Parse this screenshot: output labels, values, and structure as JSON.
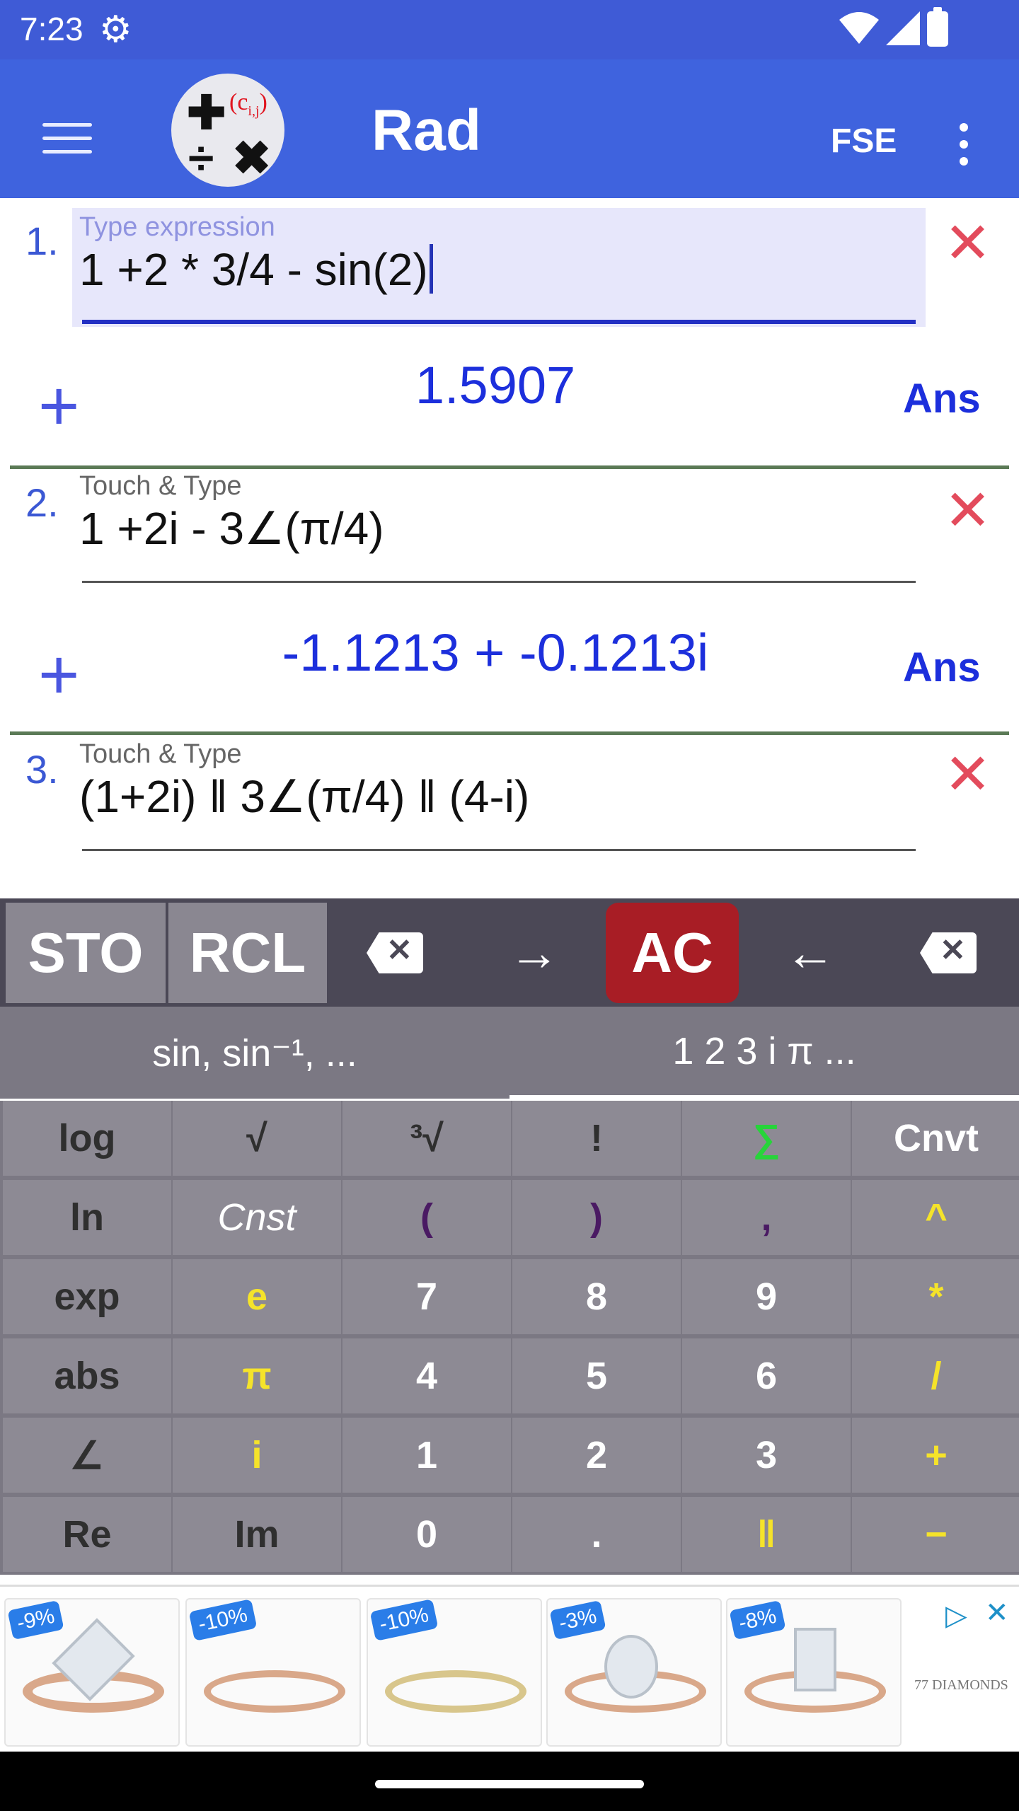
{
  "status": {
    "time": "7:23"
  },
  "appbar": {
    "mode": "Rad",
    "fse": "FSE",
    "logo_text": "c",
    "logo_sub": "i,j"
  },
  "entries": [
    {
      "num": "1.",
      "label": "Type expression",
      "expr": "1 +2 * 3/4 - sin(2)",
      "result": "1.5907",
      "ans": "Ans",
      "active": true
    },
    {
      "num": "2.",
      "label": "Touch & Type",
      "expr": "1 +2i - 3∠(π/4)",
      "result": "-1.1213 + -0.1213i",
      "ans": "Ans",
      "active": false
    },
    {
      "num": "3.",
      "label": "Touch & Type",
      "expr": "(1+2i) ǁ 3∠(π/4) ǁ (4-i)",
      "active": false
    }
  ],
  "toolbar": {
    "sto": "STO",
    "rcl": "RCL",
    "ac": "AC",
    "right": "→",
    "left": "←"
  },
  "tabs": [
    "sin, sin⁻¹, ...",
    "1 2 3 i π ..."
  ],
  "colors": {
    "yellow": "#f5e32a",
    "green": "#27d43a",
    "purple": "#4a1a63",
    "white": "#ffffff",
    "dark": "#2f2f2f"
  },
  "keys": [
    [
      {
        "t": "log",
        "c": "dark"
      },
      {
        "t": "√",
        "c": "dark"
      },
      {
        "t": "³√",
        "c": "dark"
      },
      {
        "t": "!",
        "c": "dark"
      },
      {
        "t": "∑",
        "c": "green"
      },
      {
        "t": "Cnvt",
        "c": "white"
      }
    ],
    [
      {
        "t": "ln",
        "c": "dark"
      },
      {
        "t": "Cnst",
        "c": "white",
        "i": true
      },
      {
        "t": "(",
        "c": "purple"
      },
      {
        "t": ")",
        "c": "purple"
      },
      {
        "t": ",",
        "c": "purple"
      },
      {
        "t": "^",
        "c": "yellow"
      }
    ],
    [
      {
        "t": "exp",
        "c": "dark"
      },
      {
        "t": "e",
        "c": "yellow"
      },
      {
        "t": "7",
        "c": "white"
      },
      {
        "t": "8",
        "c": "white"
      },
      {
        "t": "9",
        "c": "white"
      },
      {
        "t": "*",
        "c": "yellow"
      }
    ],
    [
      {
        "t": "abs",
        "c": "dark"
      },
      {
        "t": "π",
        "c": "yellow"
      },
      {
        "t": "4",
        "c": "white"
      },
      {
        "t": "5",
        "c": "white"
      },
      {
        "t": "6",
        "c": "white"
      },
      {
        "t": "/",
        "c": "yellow"
      }
    ],
    [
      {
        "t": "∠",
        "c": "dark"
      },
      {
        "t": "i",
        "c": "yellow"
      },
      {
        "t": "1",
        "c": "white"
      },
      {
        "t": "2",
        "c": "white"
      },
      {
        "t": "3",
        "c": "white"
      },
      {
        "t": "+",
        "c": "yellow"
      }
    ],
    [
      {
        "t": "Re",
        "c": "dark"
      },
      {
        "t": "Im",
        "c": "dark"
      },
      {
        "t": "0",
        "c": "white"
      },
      {
        "t": ".",
        "c": "white"
      },
      {
        "t": "ǁ",
        "c": "yellow"
      },
      {
        "t": "−",
        "c": "yellow"
      }
    ]
  ],
  "ad": {
    "tags": [
      "-9%",
      "-10%",
      "-10%",
      "-3%",
      "-8%"
    ],
    "brand": "77 DIAMONDS"
  }
}
